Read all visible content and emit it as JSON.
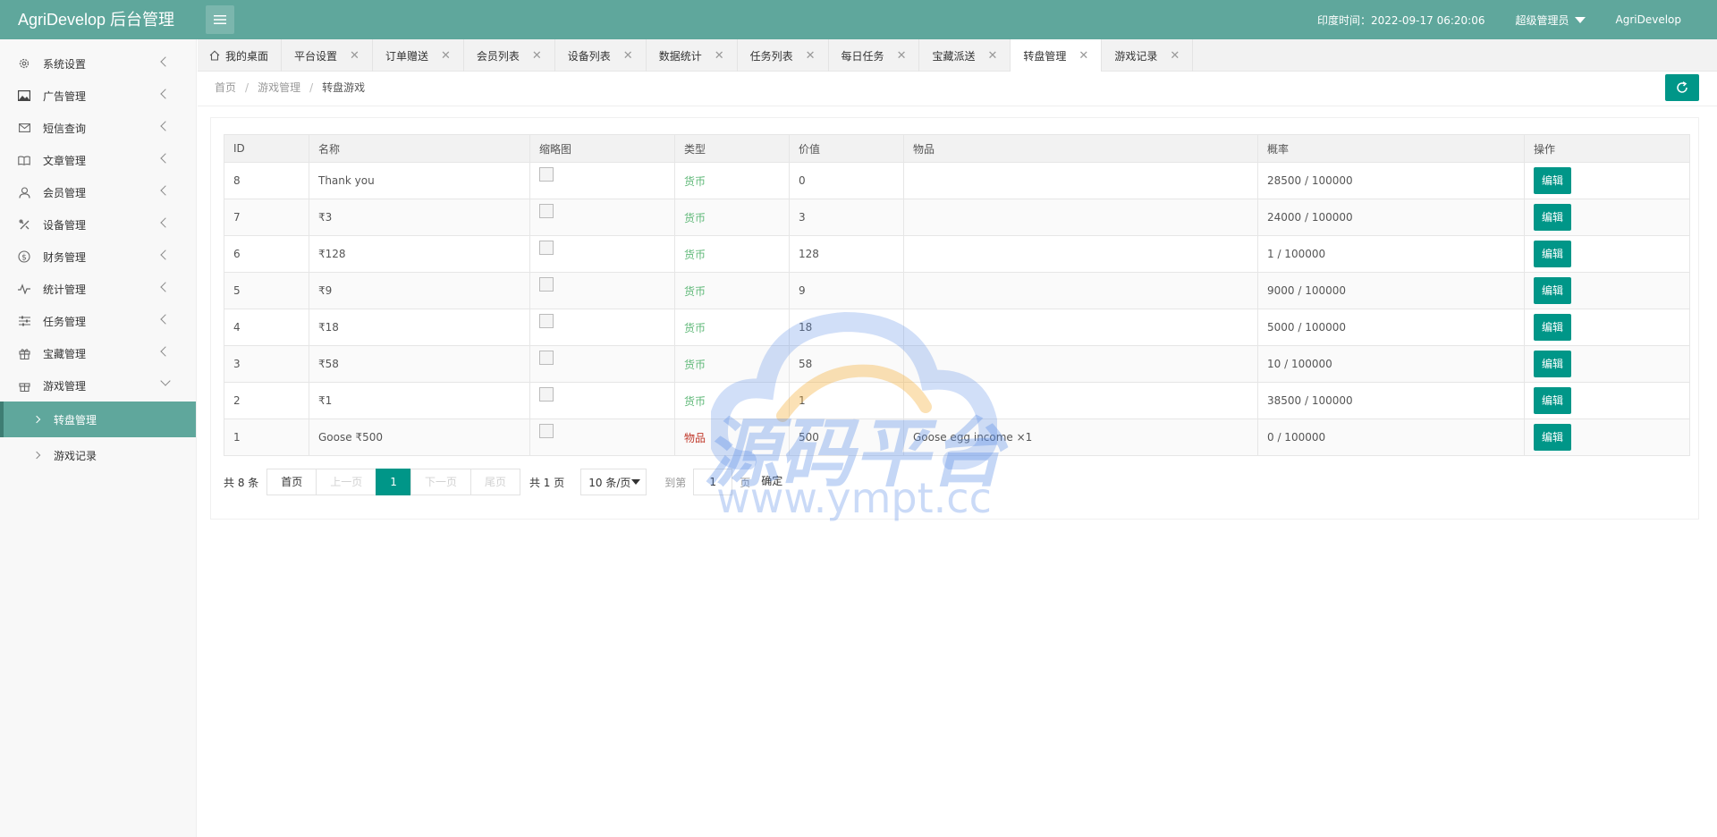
{
  "app": {
    "title": "AgriDevelop 后台管理",
    "time_label": "印度时间：2022-09-17 06:20:06",
    "admin_label": "超级管理员",
    "site_label": "AgriDevelop"
  },
  "sidebar": {
    "items": [
      {
        "label": "系统设置",
        "icon": "gear-icon"
      },
      {
        "label": "广告管理",
        "icon": "image-icon"
      },
      {
        "label": "短信查询",
        "icon": "mail-icon"
      },
      {
        "label": "文章管理",
        "icon": "book-icon"
      },
      {
        "label": "会员管理",
        "icon": "user-icon"
      },
      {
        "label": "设备管理",
        "icon": "tools-icon"
      },
      {
        "label": "财务管理",
        "icon": "dollar-icon"
      },
      {
        "label": "统计管理",
        "icon": "pulse-icon"
      },
      {
        "label": "任务管理",
        "icon": "sliders-icon"
      },
      {
        "label": "宝藏管理",
        "icon": "gift-icon"
      },
      {
        "label": "游戏管理",
        "icon": "gamepad-icon"
      }
    ],
    "sub_items": [
      {
        "label": "转盘管理",
        "active": true
      },
      {
        "label": "游戏记录",
        "active": false
      }
    ]
  },
  "tabs": [
    {
      "label": "我的桌面"
    },
    {
      "label": "平台设置"
    },
    {
      "label": "订单赠送"
    },
    {
      "label": "会员列表"
    },
    {
      "label": "设备列表"
    },
    {
      "label": "数据统计"
    },
    {
      "label": "任务列表"
    },
    {
      "label": "每日任务"
    },
    {
      "label": "宝藏派送"
    },
    {
      "label": "转盘管理"
    },
    {
      "label": "游戏记录"
    }
  ],
  "breadcrumb": {
    "home": "首页",
    "section": "游戏管理",
    "current": "转盘游戏"
  },
  "table": {
    "headers": [
      "ID",
      "名称",
      "缩略图",
      "类型",
      "价值",
      "物品",
      "概率",
      "操作"
    ],
    "edit_label": "编辑",
    "rows": [
      {
        "id": "8",
        "name": "Thank you",
        "type": "货币",
        "value": "0",
        "item": "",
        "prob": "28500 / 100000"
      },
      {
        "id": "7",
        "name": "₹3",
        "type": "货币",
        "value": "3",
        "item": "",
        "prob": "24000 / 100000"
      },
      {
        "id": "6",
        "name": "₹128",
        "type": "货币",
        "value": "128",
        "item": "",
        "prob": "1 / 100000"
      },
      {
        "id": "5",
        "name": "₹9",
        "type": "货币",
        "value": "9",
        "item": "",
        "prob": "9000 / 100000"
      },
      {
        "id": "4",
        "name": "₹18",
        "type": "货币",
        "value": "18",
        "item": "",
        "prob": "5000 / 100000"
      },
      {
        "id": "3",
        "name": "₹58",
        "type": "货币",
        "value": "58",
        "item": "",
        "prob": "10 / 100000"
      },
      {
        "id": "2",
        "name": "₹1",
        "type": "货币",
        "value": "1",
        "item": "",
        "prob": "38500 / 100000"
      },
      {
        "id": "1",
        "name": "Goose ₹500",
        "type": "物品",
        "value": "500",
        "item": "Goose egg income ×1",
        "prob": "0 / 100000"
      }
    ]
  },
  "pager": {
    "total": "共 8 条",
    "first": "首页",
    "prev": "上一页",
    "current": "1",
    "next": "下一页",
    "last": "尾页",
    "pages": "共 1 页",
    "per_page": "10 条/页",
    "goto": "到第",
    "goto_value": "1",
    "page_unit": "页",
    "confirm": "确定"
  },
  "watermark": {
    "title": "源码平台",
    "url": "www.ympt.cc"
  }
}
